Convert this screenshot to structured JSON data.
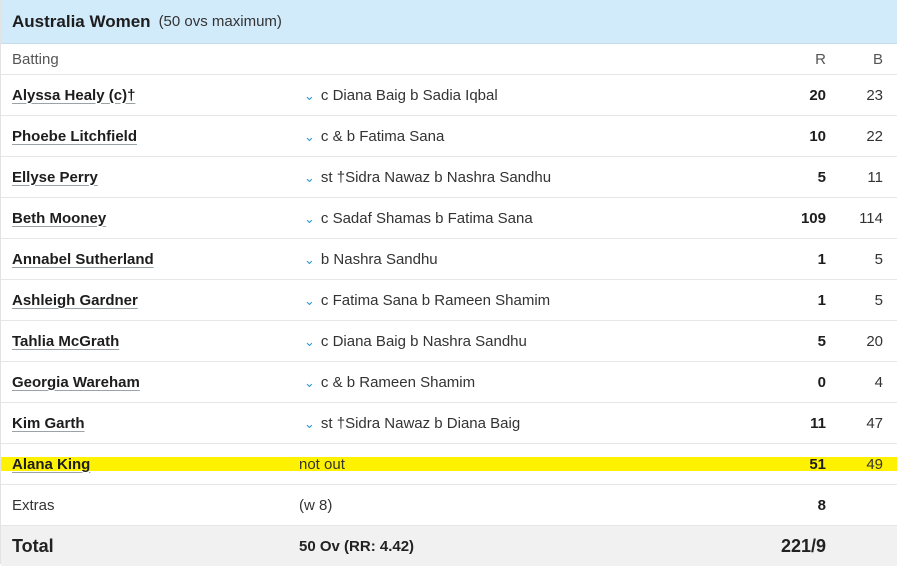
{
  "header": {
    "team": "Australia Women",
    "overs_note": "(50 ovs maximum)"
  },
  "columns": {
    "batting": "Batting",
    "runs": "R",
    "balls": "B"
  },
  "batters": [
    {
      "name": "Alyssa Healy (c)†",
      "dismissal": "c Diana Baig b Sadia Iqbal",
      "runs": "20",
      "balls": "23"
    },
    {
      "name": "Phoebe Litchfield",
      "dismissal": "c & b Fatima Sana",
      "runs": "10",
      "balls": "22"
    },
    {
      "name": "Ellyse Perry",
      "dismissal": "st †Sidra Nawaz b Nashra Sandhu",
      "runs": "5",
      "balls": "11"
    },
    {
      "name": "Beth Mooney",
      "dismissal": "c Sadaf Shamas b Fatima Sana",
      "runs": "109",
      "balls": "114"
    },
    {
      "name": "Annabel Sutherland",
      "dismissal": "b Nashra Sandhu",
      "runs": "1",
      "balls": "5"
    },
    {
      "name": "Ashleigh Gardner",
      "dismissal": "c Fatima Sana b Rameen Shamim",
      "runs": "1",
      "balls": "5"
    },
    {
      "name": "Tahlia McGrath",
      "dismissal": "c Diana Baig b Nashra Sandhu",
      "runs": "5",
      "balls": "20"
    },
    {
      "name": "Georgia Wareham",
      "dismissal": "c & b Rameen Shamim",
      "runs": "0",
      "balls": "4"
    },
    {
      "name": "Kim Garth",
      "dismissal": "st †Sidra Nawaz b Diana Baig",
      "runs": "11",
      "balls": "47"
    },
    {
      "name": "Alana King",
      "dismissal": "not out",
      "runs": "51",
      "balls": "49"
    }
  ],
  "extras": {
    "label": "Extras",
    "detail": "(w 8)",
    "runs": "8"
  },
  "total": {
    "label": "Total",
    "detail": "50 Ov (RR: 4.42)",
    "score": "221/9"
  },
  "colors": {
    "header_bg": "#d2ebfb",
    "highlight": "#fff200",
    "chevron": "#2a9bd6",
    "total_bg": "#f1f1f1"
  },
  "icons": {
    "dismissal_expand": "chevron-down-icon"
  }
}
